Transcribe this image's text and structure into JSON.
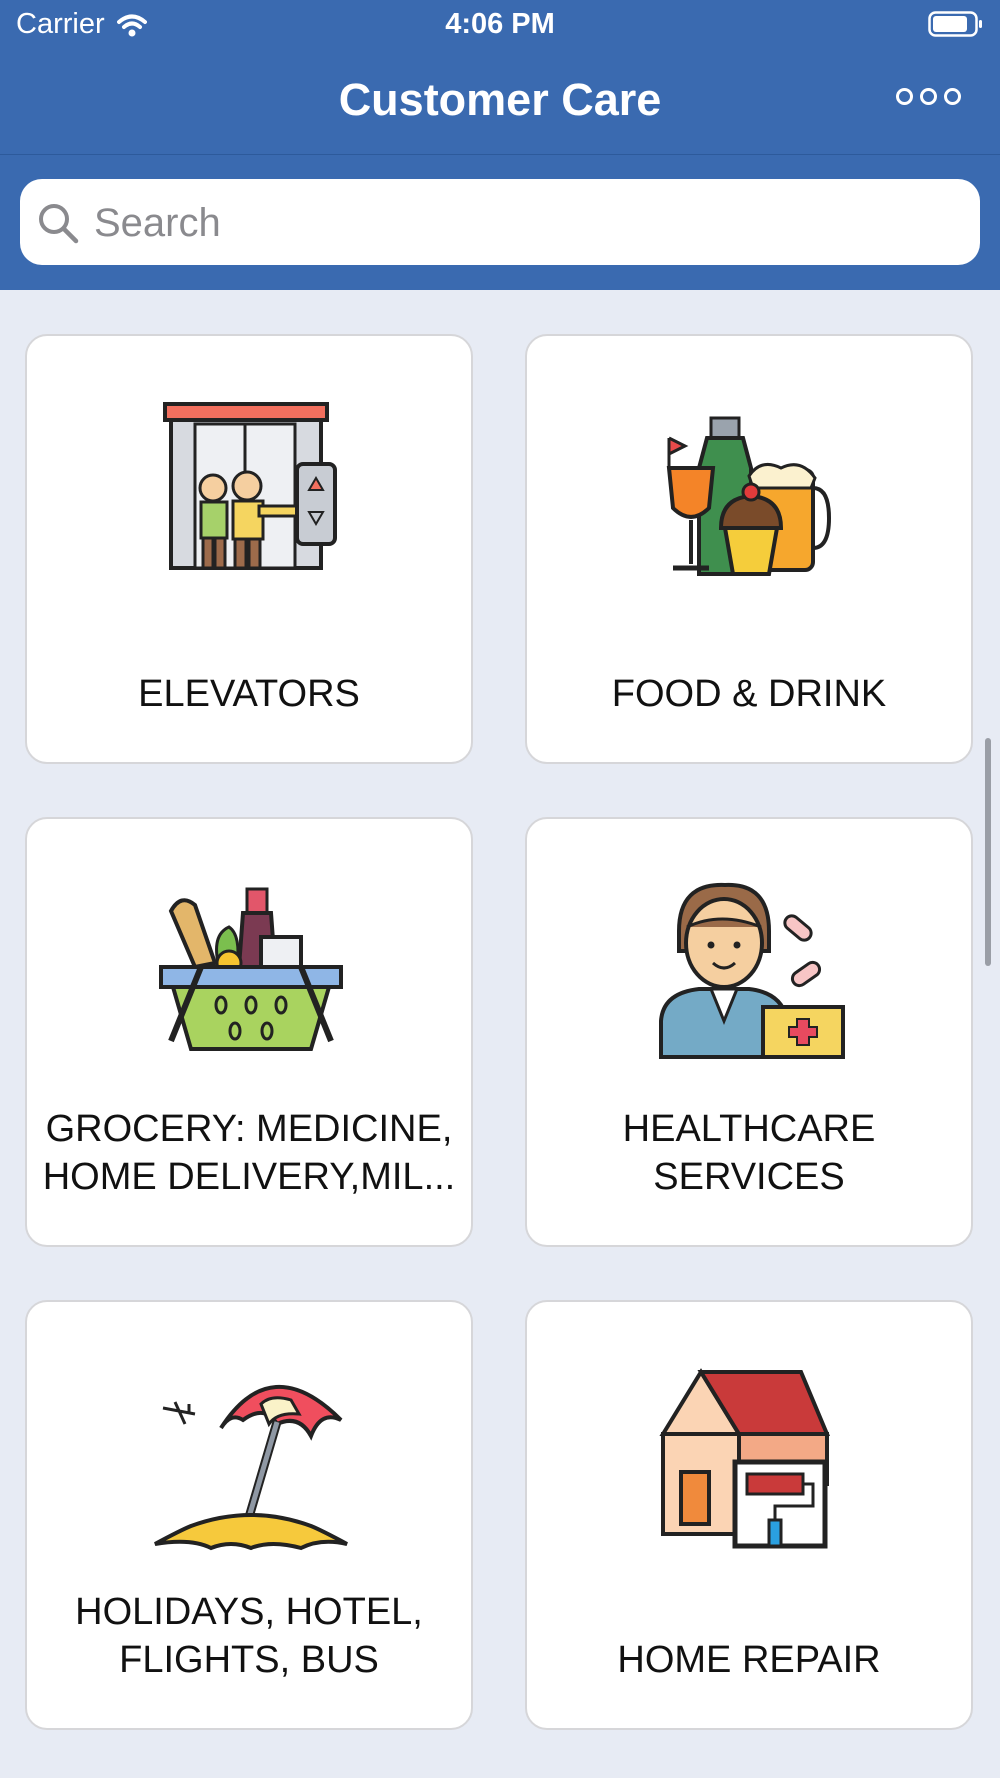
{
  "status_bar": {
    "carrier": "Carrier",
    "time": "4:06 PM"
  },
  "nav": {
    "title": "Customer Care"
  },
  "search": {
    "placeholder": "Search"
  },
  "categories": [
    {
      "label": "ELEVATORS",
      "icon": "elevator-icon"
    },
    {
      "label": "FOOD & DRINK",
      "icon": "food-drink-icon"
    },
    {
      "label": "GROCERY: MEDICINE, HOME DELIVERY,MIL...",
      "icon": "grocery-basket-icon"
    },
    {
      "label": "HEALTHCARE SERVICES",
      "icon": "doctor-icon"
    },
    {
      "label": "HOLIDAYS, HOTEL, FLIGHTS, BUS",
      "icon": "beach-umbrella-icon"
    },
    {
      "label": "HOME REPAIR",
      "icon": "house-repair-icon"
    }
  ],
  "colors": {
    "header": "#3a6ab0",
    "background": "#e7ebf4",
    "card": "#ffffff"
  }
}
